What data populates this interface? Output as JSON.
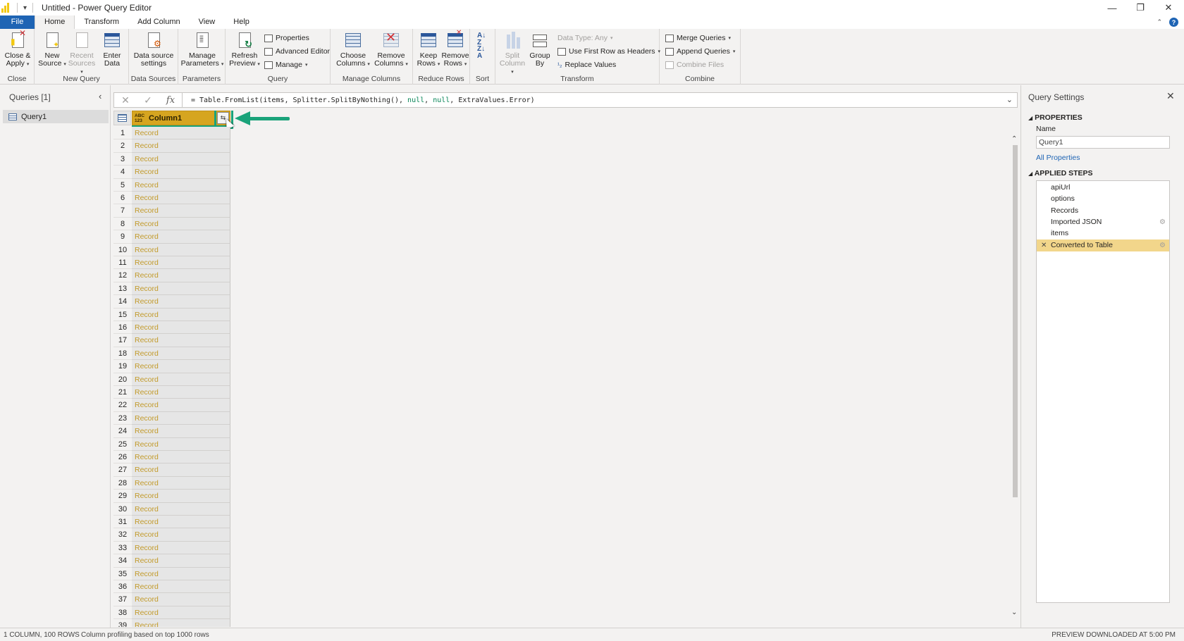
{
  "window": {
    "title": "Untitled - Power Query Editor",
    "quick_access": "▾"
  },
  "menu": {
    "tabs": [
      "File",
      "Home",
      "Transform",
      "Add Column",
      "View",
      "Help"
    ],
    "active": "Home"
  },
  "ribbon": {
    "close": {
      "group": "Close",
      "close_apply": "Close &",
      "close_apply_2": "Apply"
    },
    "new_query": {
      "group": "New Query",
      "new_source": "New",
      "new_source_2": "Source",
      "recent_sources": "Recent",
      "recent_sources_2": "Sources",
      "enter_data": "Enter",
      "enter_data_2": "Data"
    },
    "data_sources": {
      "group": "Data Sources",
      "settings": "Data source",
      "settings_2": "settings"
    },
    "parameters": {
      "group": "Parameters",
      "manage": "Manage",
      "manage_2": "Parameters"
    },
    "query": {
      "group": "Query",
      "refresh": "Refresh",
      "refresh_2": "Preview",
      "properties": "Properties",
      "advanced_editor": "Advanced Editor",
      "manage": "Manage"
    },
    "manage_columns": {
      "group": "Manage Columns",
      "choose": "Choose",
      "choose_2": "Columns",
      "remove": "Remove",
      "remove_2": "Columns"
    },
    "reduce_rows": {
      "group": "Reduce Rows",
      "keep": "Keep",
      "keep_2": "Rows",
      "remove": "Remove",
      "remove_2": "Rows"
    },
    "sort": {
      "group": "Sort"
    },
    "transform": {
      "group": "Transform",
      "split": "Split",
      "split_2": "Column",
      "group_by": "Group",
      "group_by_2": "By",
      "data_type": "Data Type: Any",
      "first_row": "Use First Row as Headers",
      "replace_values": "Replace Values"
    },
    "combine": {
      "group": "Combine",
      "merge": "Merge Queries",
      "append": "Append Queries",
      "combine_files": "Combine Files"
    }
  },
  "queries_pane": {
    "title": "Queries [1]",
    "items": [
      "Query1"
    ]
  },
  "formula_bar": {
    "prefix": "= Table.FromList(items, Splitter.SplitByNothing(), ",
    "null1": "null",
    "sep": ", ",
    "null2": "null",
    "suffix": ", ExtraValues.Error)"
  },
  "grid": {
    "column_header": "Column1",
    "type_badge_top": "ABC",
    "type_badge_bottom": "123",
    "cell_value": "Record",
    "visible_rows": 39
  },
  "settings": {
    "title": "Query Settings",
    "properties_title": "PROPERTIES",
    "name_label": "Name",
    "name_value": "Query1",
    "all_properties": "All Properties",
    "applied_steps_title": "APPLIED STEPS",
    "steps": [
      {
        "label": "apiUrl",
        "gear": false,
        "active": false
      },
      {
        "label": "options",
        "gear": false,
        "active": false
      },
      {
        "label": "Records",
        "gear": false,
        "active": false
      },
      {
        "label": "Imported JSON",
        "gear": true,
        "active": false
      },
      {
        "label": "items",
        "gear": false,
        "active": false
      },
      {
        "label": "Converted to Table",
        "gear": true,
        "active": true
      }
    ]
  },
  "statusbar": {
    "columns_rows": "1 COLUMN, 100 ROWS",
    "profiling": "Column profiling based on top 1000 rows",
    "preview": "PREVIEW DOWNLOADED AT 5:00 PM"
  },
  "colors": {
    "accent": "#1e64b4",
    "column_header": "#d6a520",
    "record_text": "#c29a2a",
    "highlight_green": "#1aa37a",
    "active_step": "#f2d68b"
  }
}
